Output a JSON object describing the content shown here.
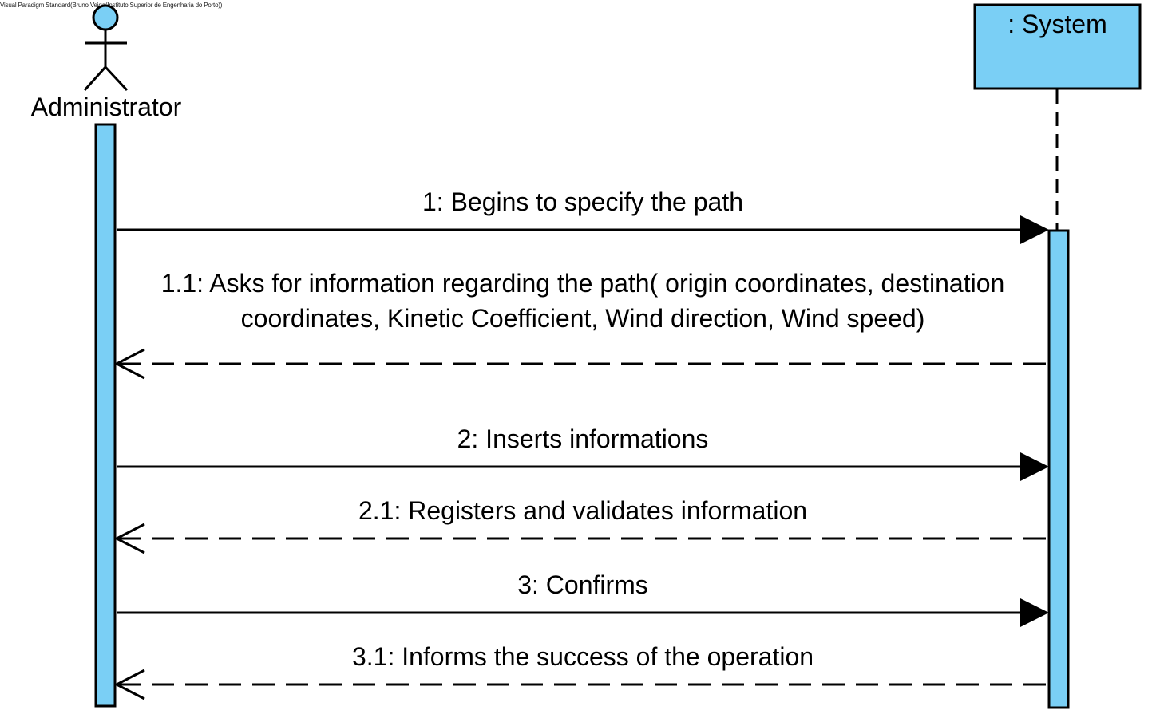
{
  "watermark": "Visual Paradigm Standard(Bruno Veiga(Instituto Superior de Engenharia do Porto))",
  "participants": {
    "actor": {
      "name": "Administrator"
    },
    "system": {
      "name": ": System"
    }
  },
  "messages": [
    {
      "label": "1: Begins to specify the path",
      "kind": "sync"
    },
    {
      "label_line1": "1.1: Asks for information regarding the path( origin coordinates, destination",
      "label_line2": "coordinates, Kinetic Coefficient, Wind direction, Wind speed)",
      "kind": "return"
    },
    {
      "label": "2: Inserts informations",
      "kind": "sync"
    },
    {
      "label": "2.1: Registers and validates information",
      "kind": "return"
    },
    {
      "label": "3: Confirms",
      "kind": "sync"
    },
    {
      "label": "3.1: Informs the success of the operation",
      "kind": "return"
    }
  ],
  "colors": {
    "fill": "#7ACFF5",
    "stroke": "#000000"
  }
}
